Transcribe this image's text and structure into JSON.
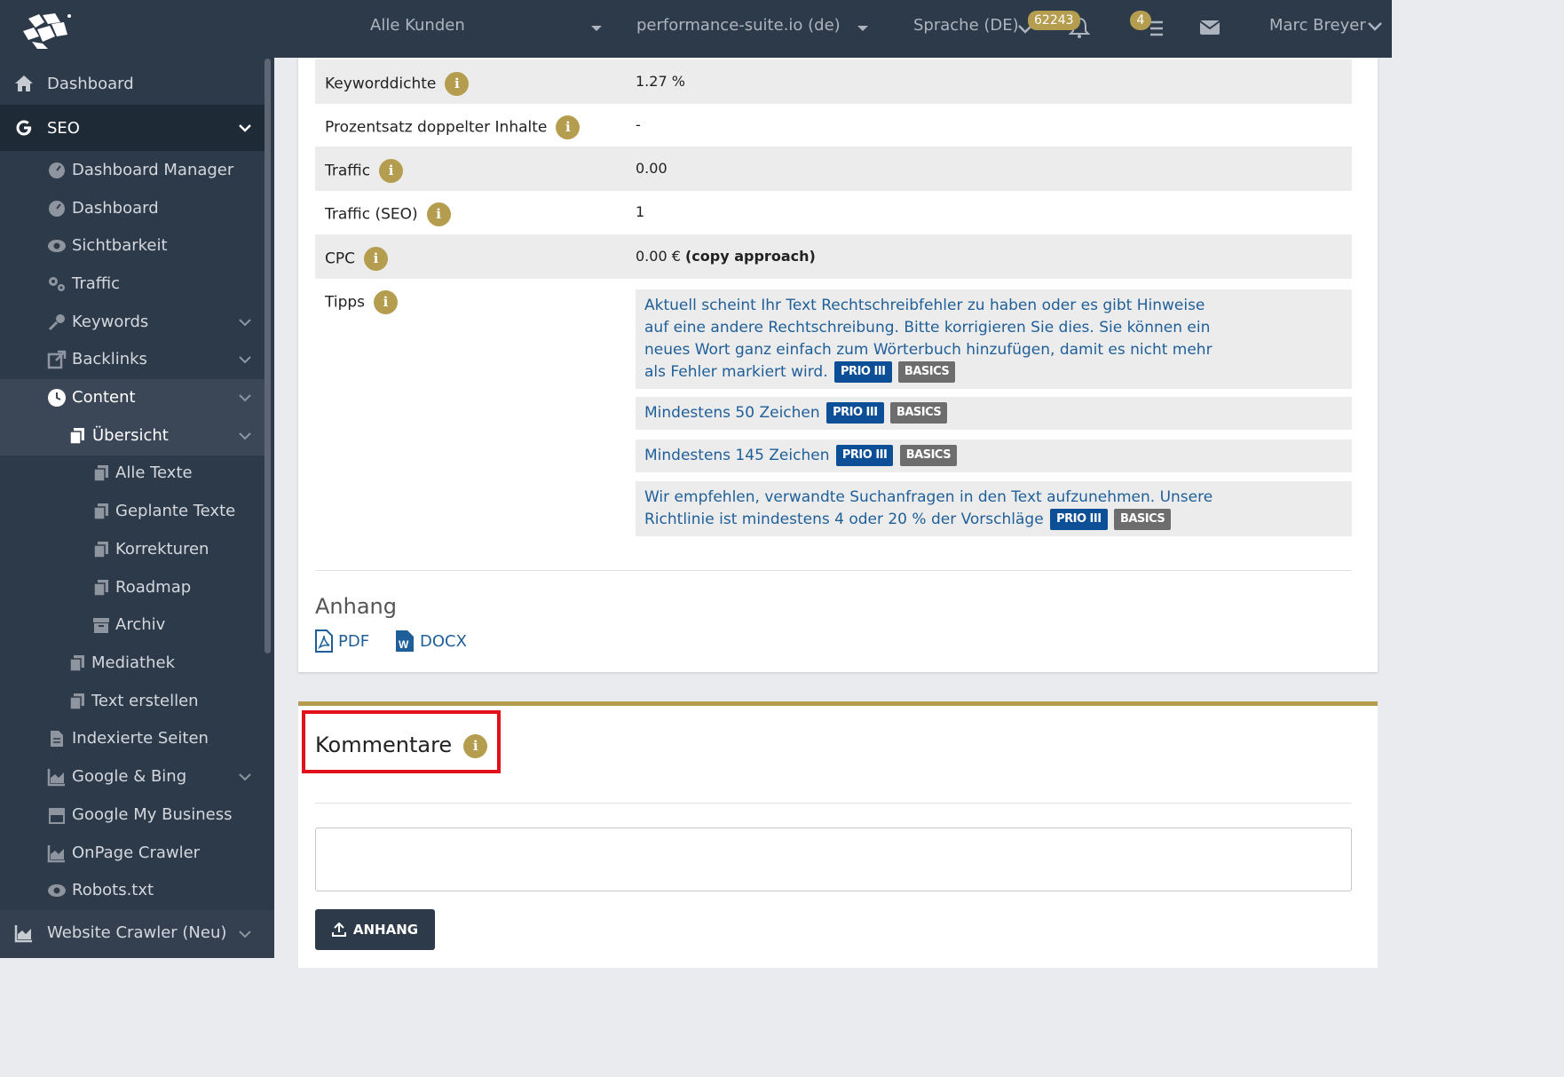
{
  "topbar": {
    "customers": "Alle Kunden",
    "domain": "performance-suite.io (de)",
    "language": "Sprache (DE)",
    "notification_count": "62243",
    "task_count": "4",
    "user": "Marc Breyer"
  },
  "sidebar": {
    "dashboard": "Dashboard",
    "seo": "SEO",
    "items": {
      "dashboard_manager": "Dashboard Manager",
      "dashboard": "Dashboard",
      "sichtbarkeit": "Sichtbarkeit",
      "traffic": "Traffic",
      "keywords": "Keywords",
      "backlinks": "Backlinks",
      "content": "Content",
      "uebersicht": "Übersicht",
      "alle_texte": "Alle Texte",
      "geplante_texte": "Geplante Texte",
      "korrekturen": "Korrekturen",
      "roadmap": "Roadmap",
      "archiv": "Archiv",
      "mediathek": "Mediathek",
      "text_erstellen": "Text erstellen",
      "indexierte_seiten": "Indexierte Seiten",
      "google_bing": "Google & Bing",
      "google_my_business": "Google My Business",
      "onpage_crawler": "OnPage Crawler",
      "robots": "Robots.txt",
      "website_crawler": "Website Crawler (Neu)"
    }
  },
  "details": {
    "keyworddichte": {
      "label": "Keyworddichte",
      "value": "1.27 %"
    },
    "duplicate": {
      "label": "Prozentsatz doppelter Inhalte",
      "value": "-"
    },
    "traffic": {
      "label": "Traffic",
      "value": "0.00"
    },
    "traffic_seo": {
      "label": "Traffic (SEO)",
      "value": "1"
    },
    "cpc": {
      "label": "CPC",
      "value": "0.00 €",
      "note": "(copy approach)"
    },
    "tipps": {
      "label": "Tipps"
    }
  },
  "tips": [
    {
      "text": "Aktuell scheint Ihr Text Rechtschreibfehler zu haben oder es gibt Hinweise auf eine andere Rechtschreibung. Bitte korrigieren Sie dies. Sie können ein neues Wort ganz einfach zum Wörterbuch hinzufügen, damit es nicht mehr als Fehler markiert wird.",
      "prio": "PRIO III",
      "cat": "BASICS"
    },
    {
      "text": "Mindestens 50 Zeichen",
      "prio": "PRIO III",
      "cat": "BASICS"
    },
    {
      "text": "Mindestens 145 Zeichen",
      "prio": "PRIO III",
      "cat": "BASICS"
    },
    {
      "text": "Wir empfehlen, verwandte Suchanfragen in den Text aufzunehmen. Unsere Richtlinie ist mindestens 4 oder 20 % der Vorschläge",
      "prio": "PRIO III",
      "cat": "BASICS"
    }
  ],
  "attachments": {
    "heading": "Anhang",
    "pdf": "PDF",
    "docx": "DOCX"
  },
  "comments": {
    "title": "Kommentare",
    "upload_button": "ANHANG",
    "textarea_value": ""
  },
  "colors": {
    "nav_bg": "#2d3a4a",
    "accent_gold": "#b49d4e",
    "link_blue": "#1f5f99",
    "prio_blue": "#0d4f96",
    "basics_gray": "#6d6d6d",
    "highlight_red": "#e0101c"
  }
}
